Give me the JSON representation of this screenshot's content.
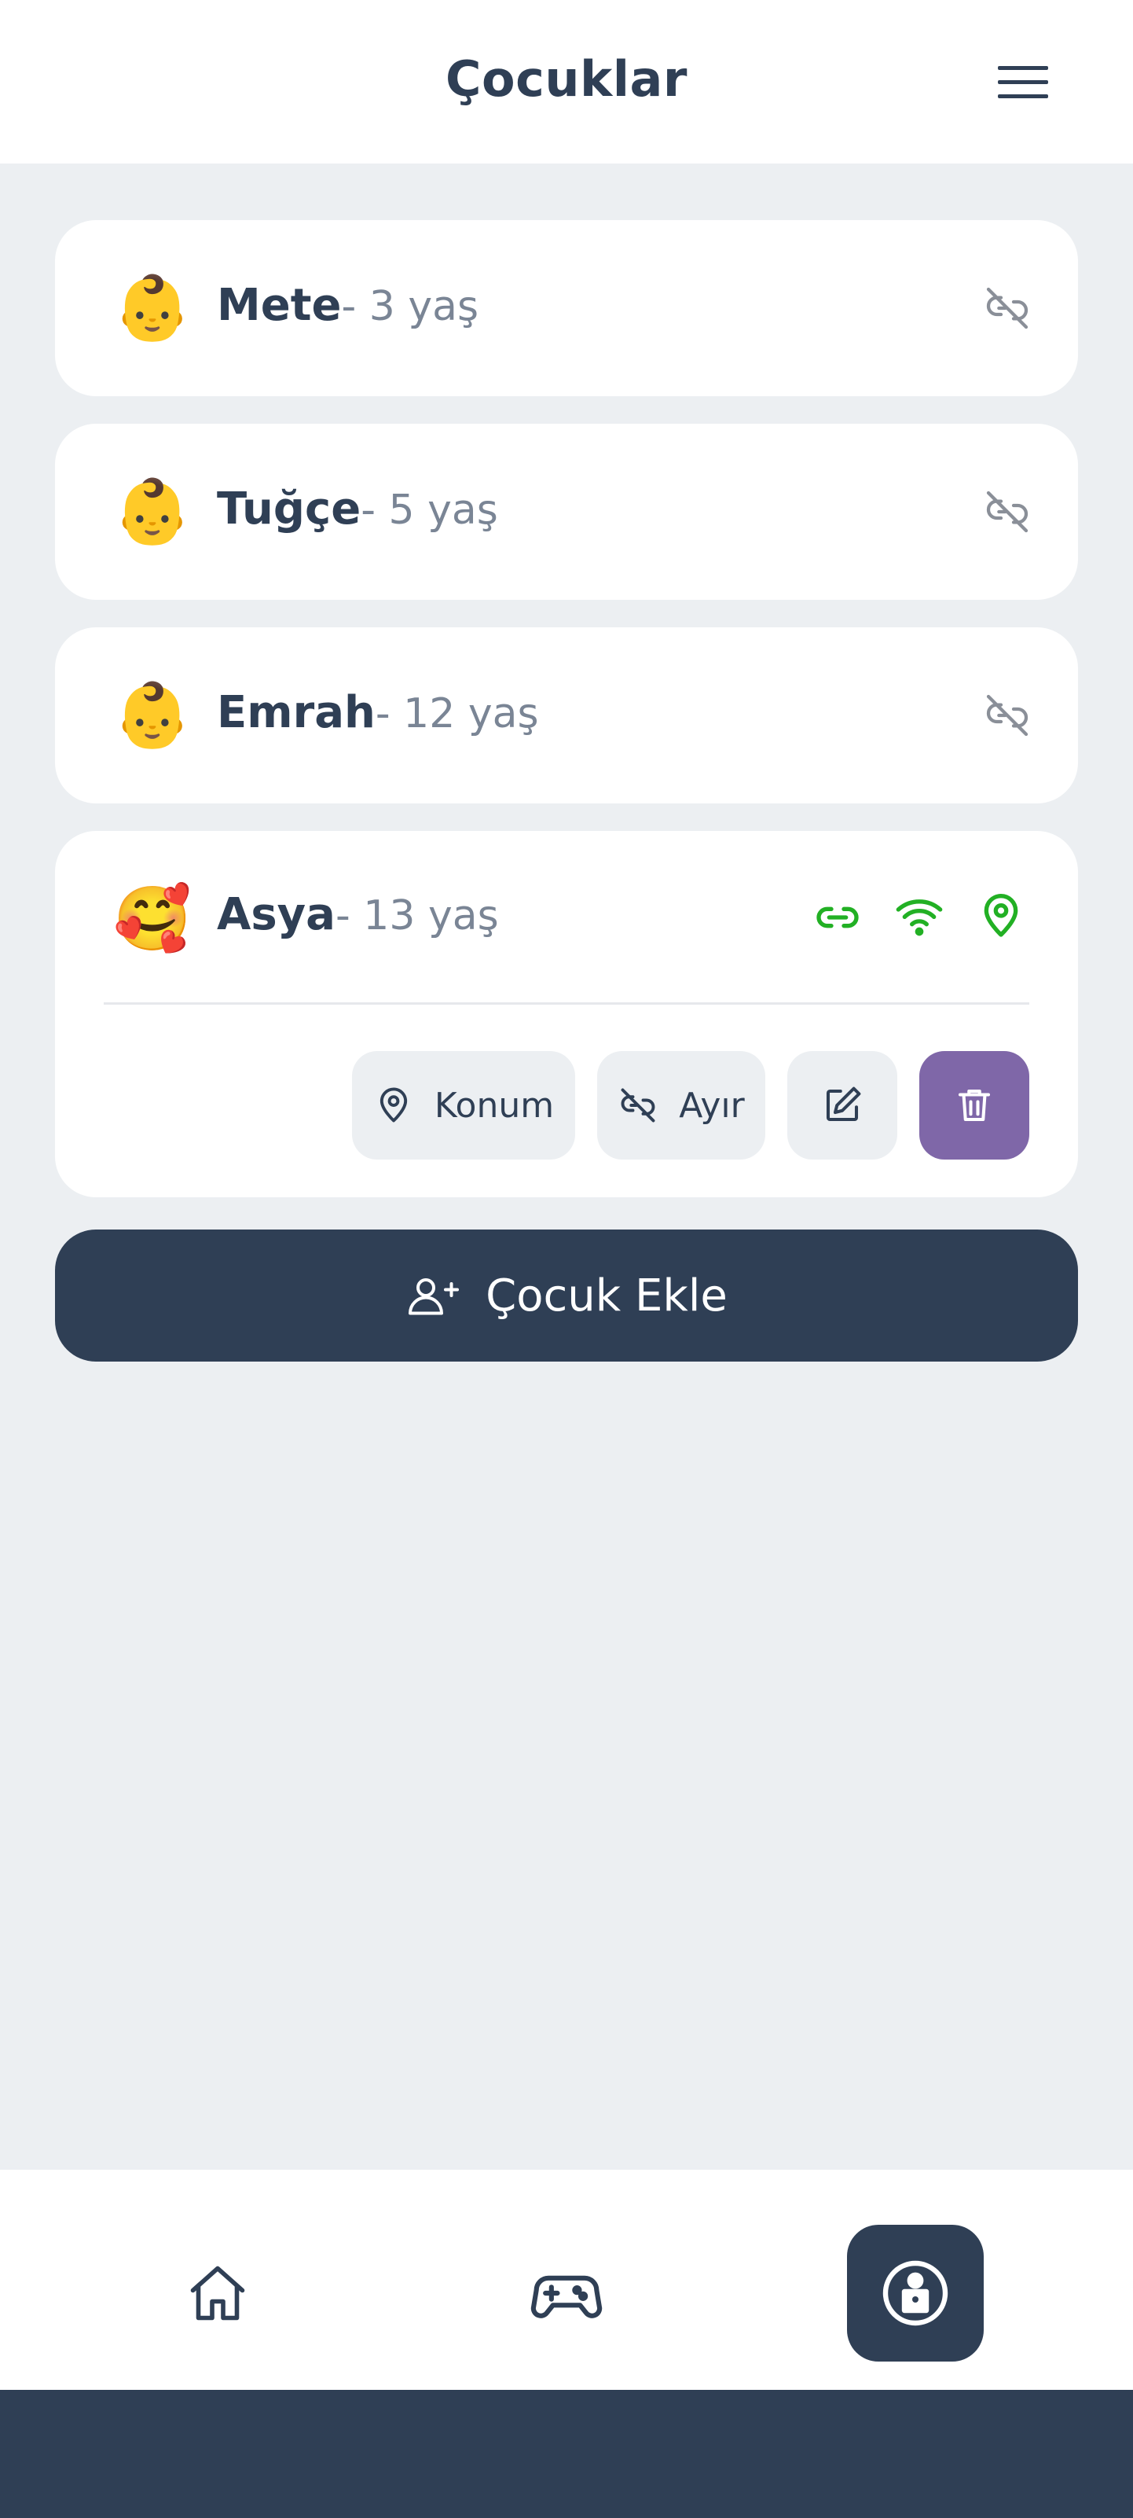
{
  "header": {
    "title": "Çocuklar",
    "menu_icon": "hamburger-menu-icon"
  },
  "children": [
    {
      "name": "Mete",
      "age": "- 3 yaş",
      "avatar": "👶",
      "status": "disconnected"
    },
    {
      "name": "Tuğçe",
      "age": "- 5 yaş",
      "avatar": "👶",
      "status": "disconnected"
    },
    {
      "name": "Emrah",
      "age": "- 12 yaş",
      "avatar": "👶",
      "status": "disconnected"
    },
    {
      "name": "Asya",
      "age": "- 13 yaş",
      "avatar": "🥰",
      "status": "connected"
    }
  ],
  "expanded_child": {
    "actions": {
      "location_label": "Konum",
      "unlink_label": "Ayır",
      "edit_icon": "edit-icon",
      "delete_icon": "trash-icon"
    }
  },
  "add_child_label": "Çocuk Ekle",
  "nav": {
    "items": [
      "home-icon",
      "gamepad-icon",
      "child-profile-icon"
    ],
    "active": "child-profile-icon"
  },
  "colors": {
    "primary": "#2f3f55",
    "background": "#eceff2",
    "connected_green": "#22b024",
    "delete_purple": "#7f67a8",
    "muted_icon": "#8a8f98"
  }
}
